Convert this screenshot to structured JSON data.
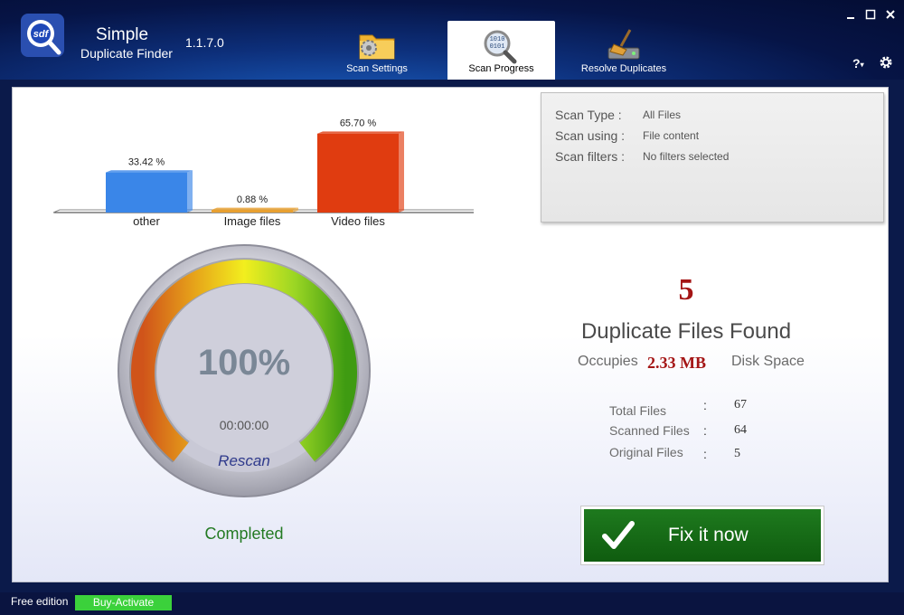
{
  "app": {
    "name": "Simple",
    "subtitle": "Duplicate Finder",
    "version": "1.1.7.0"
  },
  "window": {
    "minimize_icon": "minimize-icon",
    "maximize_icon": "maximize-icon",
    "close_icon": "close-icon"
  },
  "tabs": [
    {
      "label": "Scan Settings",
      "icon": "folder-gear-icon",
      "active": false
    },
    {
      "label": "Scan Progress",
      "icon": "binary-magnifier-icon",
      "active": true
    },
    {
      "label": "Resolve Duplicates",
      "icon": "drive-broom-icon",
      "active": false
    }
  ],
  "header_buttons": {
    "help": "?",
    "settings_icon": "gear-icon"
  },
  "chart_data": {
    "type": "bar",
    "categories": [
      "other",
      "Image files",
      "Video files"
    ],
    "values": [
      33.42,
      0.88,
      65.7
    ],
    "value_labels": [
      "33.42 %",
      "0.88 %",
      "65.70 %"
    ],
    "colors": [
      "#3a86e8",
      "#e8a030",
      "#e03c10"
    ],
    "ylim": [
      0,
      70
    ],
    "grid": false
  },
  "scan_info": {
    "type_label": "Scan Type :",
    "type_value": "All Files",
    "using_label": "Scan using :",
    "using_value": "File content",
    "filters_label": "Scan filters :",
    "filters_value": "No filters selected"
  },
  "progress": {
    "percent": 100,
    "percent_text": "100%",
    "timer": "00:00:00",
    "rescan_label": "Rescan",
    "status": "Completed"
  },
  "results": {
    "duplicate_count": "5",
    "title": "Duplicate Files Found",
    "occupies_label": "Occupies",
    "occupies_value": "2.33 MB",
    "occupies_suffix": "Disk Space",
    "stats": [
      {
        "label": "Total Files",
        "value": "67"
      },
      {
        "label": "Scanned Files",
        "value": "64"
      },
      {
        "label": "Original Files",
        "value": "5"
      }
    ]
  },
  "fix_button": {
    "label": "Fix it now",
    "icon": "checkmark-icon"
  },
  "statusbar": {
    "edition": "Free edition",
    "buy_label": "Buy-Activate"
  }
}
